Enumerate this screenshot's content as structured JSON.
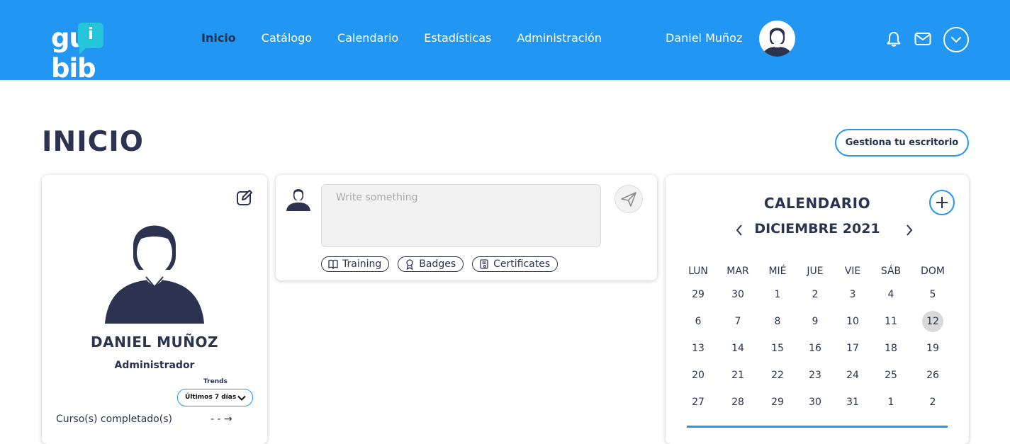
{
  "header": {
    "logo_text_left": "gu",
    "logo_bubble": "i",
    "logo_text_right": "bib",
    "nav": [
      {
        "label": "Inicio",
        "active": true
      },
      {
        "label": "Catálogo",
        "active": false
      },
      {
        "label": "Calendario",
        "active": false
      },
      {
        "label": "Estadísticas",
        "active": false
      },
      {
        "label": "Administración",
        "active": false
      }
    ],
    "user_name": "Daniel Muñoz",
    "icons": [
      "bell-icon",
      "mail-icon",
      "chevron-down-icon"
    ]
  },
  "page": {
    "title": "INICIO",
    "manage_button": "Gestiona tu escritorio"
  },
  "profile": {
    "name": "DANIEL MUÑOZ",
    "role": "Administrador",
    "trends_label": "Trends",
    "trends_selected": "Últimos 7 días",
    "stat_label": "Curso(s) completado(s)",
    "stat_value": "- - →"
  },
  "post": {
    "placeholder": "Write something",
    "chips": [
      {
        "label": "Training",
        "icon": "book-icon"
      },
      {
        "label": "Badges",
        "icon": "badge-icon"
      },
      {
        "label": "Certificates",
        "icon": "certificate-icon"
      }
    ]
  },
  "calendar": {
    "title": "CALENDARIO",
    "month": "DICIEMBRE 2021",
    "weekdays": [
      "LUN",
      "MAR",
      "MIÉ",
      "JUE",
      "VIE",
      "SÁB",
      "DOM"
    ],
    "weeks": [
      [
        {
          "d": "29",
          "m": true
        },
        {
          "d": "30",
          "m": true
        },
        {
          "d": "1"
        },
        {
          "d": "2"
        },
        {
          "d": "3"
        },
        {
          "d": "4"
        },
        {
          "d": "5"
        }
      ],
      [
        {
          "d": "6"
        },
        {
          "d": "7"
        },
        {
          "d": "8"
        },
        {
          "d": "9"
        },
        {
          "d": "10"
        },
        {
          "d": "11"
        },
        {
          "d": "12",
          "t": true
        }
      ],
      [
        {
          "d": "13"
        },
        {
          "d": "14"
        },
        {
          "d": "15"
        },
        {
          "d": "16"
        },
        {
          "d": "17"
        },
        {
          "d": "18"
        },
        {
          "d": "19"
        }
      ],
      [
        {
          "d": "20"
        },
        {
          "d": "21"
        },
        {
          "d": "22"
        },
        {
          "d": "23"
        },
        {
          "d": "24"
        },
        {
          "d": "25"
        },
        {
          "d": "26"
        }
      ],
      [
        {
          "d": "27"
        },
        {
          "d": "28"
        },
        {
          "d": "29"
        },
        {
          "d": "30"
        },
        {
          "d": "31"
        },
        {
          "d": "1",
          "m": true
        },
        {
          "d": "2",
          "m": true
        }
      ]
    ]
  },
  "colors": {
    "primary": "#2196f3",
    "navy": "#2b3350",
    "logo_accent": "#26c6da"
  }
}
